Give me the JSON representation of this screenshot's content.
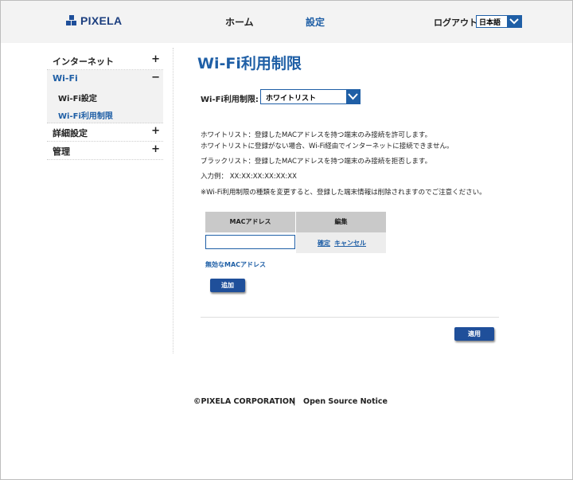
{
  "brand": {
    "name": "PIXELA",
    "color": "#1f4f9a"
  },
  "nav": {
    "home": "ホーム",
    "settings": "設定",
    "logout": "ログアウト",
    "language": "日本語"
  },
  "sidebar": {
    "items": [
      {
        "label": "インターネット",
        "toggle": "+"
      },
      {
        "label": "Wi-Fi",
        "toggle": "−",
        "sub": [
          "Wi-Fi設定",
          "Wi-Fi利用制限"
        ]
      },
      {
        "label": "詳細設定",
        "toggle": "+"
      },
      {
        "label": "管理",
        "toggle": "+"
      }
    ]
  },
  "main": {
    "title": "Wi-Fi利用制限",
    "filter_label": "Wi-Fi利用制限:",
    "filter_value": "ホワイトリスト",
    "desc": [
      "ホワイトリスト：登録したMACアドレスを持つ端末のみ接続を許可します。",
      "ホワイトリストに登録がない場合、Wi-Fi経由でインターネットに接続できません。",
      "ブラックリスト：登録したMACアドレスを持つ端末のみ接続を拒否します。",
      "入力例：  XX:XX:XX:XX:XX:XX",
      "※Wi-Fi利用制限の種類を変更すると、登録した端末情報は削除されますのでご注意ください。"
    ],
    "table": {
      "headers": [
        "MACアドレス",
        "編集"
      ],
      "mac_value": "",
      "confirm": "確定",
      "cancel": "キャンセル"
    },
    "invalid_mac": "無効なMACアドレス",
    "add_button": "追加",
    "apply_button": "適用"
  },
  "footer": {
    "copyright": "©PIXELA  CORPORATION",
    "sep": "|",
    "oss": "Open Source Notice"
  },
  "colors": {
    "accent": "#1f5fa6",
    "header_bg": "#f3f3f3"
  }
}
